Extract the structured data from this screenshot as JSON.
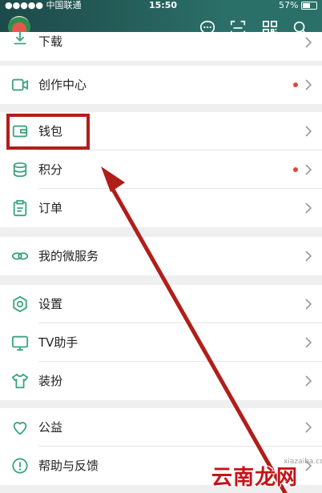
{
  "status_bar": {
    "carrier": "●●●●● 中国联通",
    "time": "15:50",
    "battery": "57%"
  },
  "header": {
    "icons": [
      "chat-bubble-icon",
      "scan-icon",
      "qr-code-icon",
      "search-icon"
    ]
  },
  "menu": {
    "download": {
      "label": "下载"
    },
    "creator_center": {
      "label": "创作中心"
    },
    "wallet": {
      "label": "钱包"
    },
    "points": {
      "label": "积分"
    },
    "orders": {
      "label": "订单"
    },
    "my_microservices": {
      "label": "我的微服务"
    },
    "settings": {
      "label": "设置"
    },
    "tv_assistant": {
      "label": "TV助手"
    },
    "outfit": {
      "label": "装扮"
    },
    "charity": {
      "label": "公益"
    },
    "help_feedback": {
      "label": "帮助与反馈"
    }
  },
  "watermark": {
    "main": "云南龙网",
    "sub": "xiazaiba.com"
  },
  "colors": {
    "header": "#2b6f69",
    "accent": "#3aa57a",
    "highlight": "#b11e1a",
    "badge": "#e2463f"
  }
}
